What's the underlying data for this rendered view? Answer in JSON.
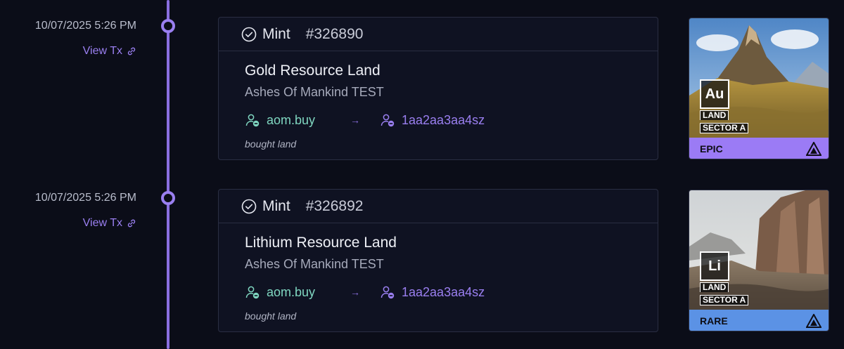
{
  "events": [
    {
      "date": "10/07/2025 5:26 PM",
      "view_tx": "View Tx",
      "event_type": "Mint",
      "token_id": "#326890",
      "title": "Gold Resource Land",
      "collection": "Ashes Of Mankind TEST",
      "from": "aom.buy",
      "arrow": "→",
      "to": "1aa2aa3aa4sz",
      "note": "bought land",
      "nft": {
        "symbol": "Au",
        "land_label": "LAND",
        "sector_label": "SECTOR A",
        "rarity": "EPIC",
        "rarity_color": "#9b7bf5",
        "scene": "golden-mountain"
      }
    },
    {
      "date": "10/07/2025 5:26 PM",
      "view_tx": "View Tx",
      "event_type": "Mint",
      "token_id": "#326892",
      "title": "Lithium Resource Land",
      "collection": "Ashes Of Mankind TEST",
      "from": "aom.buy",
      "arrow": "→",
      "to": "1aa2aa3aa4sz",
      "note": "bought land",
      "nft": {
        "symbol": "Li",
        "land_label": "LAND",
        "sector_label": "SECTOR A",
        "rarity": "RARE",
        "rarity_color": "#5b92e5",
        "scene": "rock-canyon"
      }
    }
  ],
  "icons": {
    "link": "link-icon",
    "check": "check-circle-icon",
    "user_from": "user-minus-icon",
    "user_to": "user-minus-icon",
    "brand": "aom-logo-icon"
  },
  "colors": {
    "accent": "#9a7ff0",
    "from_address": "#7fd6c0",
    "background": "#0b0d18",
    "card": "#0f1222"
  }
}
